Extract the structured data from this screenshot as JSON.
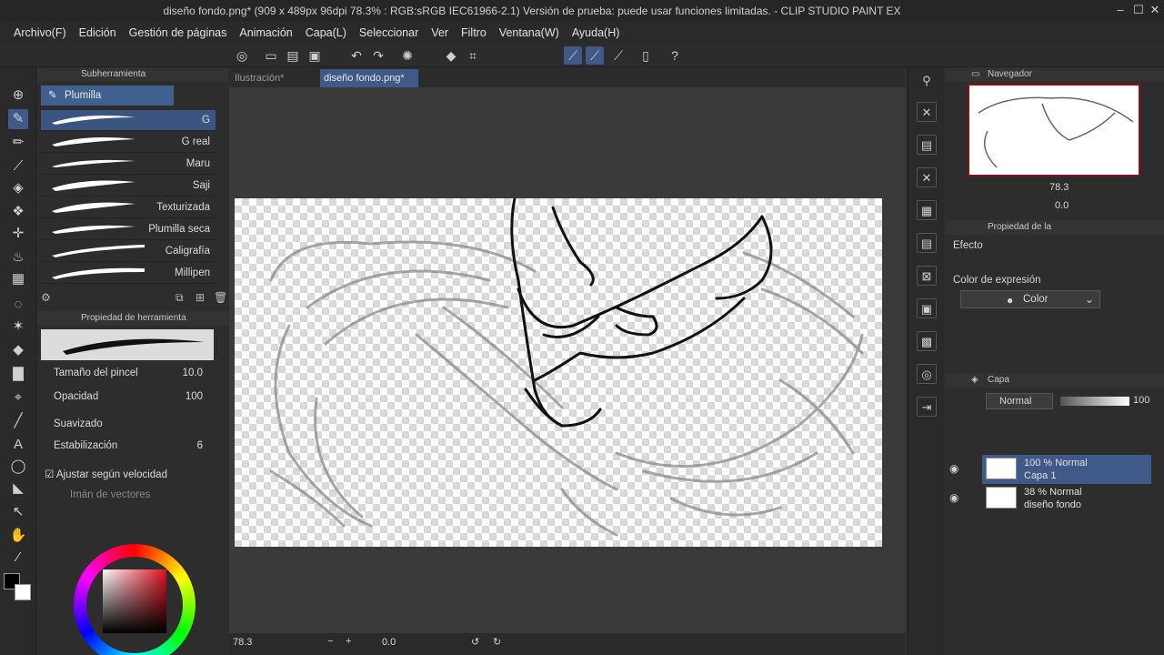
{
  "window": {
    "title": "diseño fondo.png* (909 x 489px 96dpi 78.3% : RGB:sRGB IEC61966-2.1)  Versión de prueba: puede usar funciones limitadas. - CLIP STUDIO PAINT EX"
  },
  "menu": [
    "Archivo(F)",
    "Edición",
    "Gestión de páginas",
    "Animación",
    "Capa(L)",
    "Seleccionar",
    "Ver",
    "Filtro",
    "Ventana(W)",
    "Ayuda(H)"
  ],
  "subtool": {
    "header": "Subherramienta",
    "group": "Plumilla",
    "brushes": [
      "G",
      "G real",
      "Maru",
      "Saji",
      "Texturizada",
      "Plumilla seca",
      "Caligrafía",
      "Millipen"
    ]
  },
  "tool_property": {
    "header": "Propiedad de herramienta",
    "brush_size_label": "Tamaño del pincel",
    "brush_size": "10.0",
    "opacity_label": "Opacidad",
    "opacity": "100",
    "smoothing_label": "Suavizado",
    "stabilization_label": "Estabilización",
    "stabilization": "6",
    "speed_label": "Ajustar según velocidad",
    "vector_label": "Imán de vectores"
  },
  "tabs": [
    "Ilustración*",
    "diseño fondo.png*"
  ],
  "status": {
    "zoom": "78.3",
    "angle": "0.0"
  },
  "navigator": {
    "header": "Navegador",
    "zoom": "78.3",
    "angle": "0.0"
  },
  "layer_property": {
    "header": "Propiedad de la",
    "effect_label": "Efecto",
    "expression_label": "Color de expresión",
    "expression_value": "Color"
  },
  "layers": {
    "header": "Capa",
    "blend_mode": "Normal",
    "opacity": "100",
    "items": [
      {
        "mode": "100 % Normal",
        "name": "Capa 1"
      },
      {
        "mode": "38 % Normal",
        "name": "diseño fondo"
      }
    ]
  },
  "colors": {
    "accent": "#3f5a88",
    "main_color": "#000000",
    "sub_color": "#ffffff"
  }
}
